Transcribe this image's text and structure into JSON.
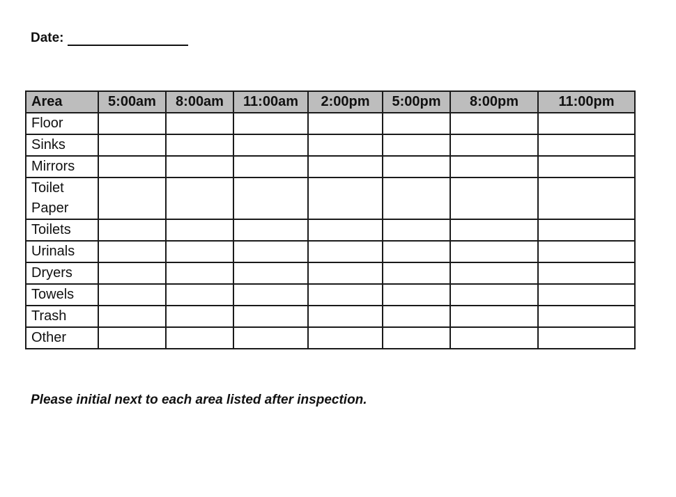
{
  "date_field": {
    "label": "Date:",
    "value": ""
  },
  "table": {
    "headers": [
      "Area",
      "5:00am",
      "8:00am",
      "11:00am",
      "2:00pm",
      "5:00pm",
      "8:00pm",
      "11:00pm"
    ],
    "rows": [
      {
        "area": "Floor",
        "cells": [
          "",
          "",
          "",
          "",
          "",
          "",
          ""
        ]
      },
      {
        "area": "Sinks",
        "cells": [
          "",
          "",
          "",
          "",
          "",
          "",
          ""
        ]
      },
      {
        "area": "Mirrors",
        "cells": [
          "",
          "",
          "",
          "",
          "",
          "",
          ""
        ]
      },
      {
        "area": "Toilet Paper",
        "cells": [
          "",
          "",
          "",
          "",
          "",
          "",
          ""
        ]
      },
      {
        "area": "Toilets",
        "cells": [
          "",
          "",
          "",
          "",
          "",
          "",
          ""
        ]
      },
      {
        "area": "Urinals",
        "cells": [
          "",
          "",
          "",
          "",
          "",
          "",
          ""
        ]
      },
      {
        "area": "Dryers",
        "cells": [
          "",
          "",
          "",
          "",
          "",
          "",
          ""
        ]
      },
      {
        "area": "Towels",
        "cells": [
          "",
          "",
          "",
          "",
          "",
          "",
          ""
        ]
      },
      {
        "area": "Trash",
        "cells": [
          "",
          "",
          "",
          "",
          "",
          "",
          ""
        ]
      },
      {
        "area": "Other",
        "cells": [
          "",
          "",
          "",
          "",
          "",
          "",
          ""
        ]
      }
    ]
  },
  "note": "Please initial next to each area listed after inspection.",
  "colors": {
    "header_background": "#bdbdbd",
    "border": "#1a1a1a"
  }
}
